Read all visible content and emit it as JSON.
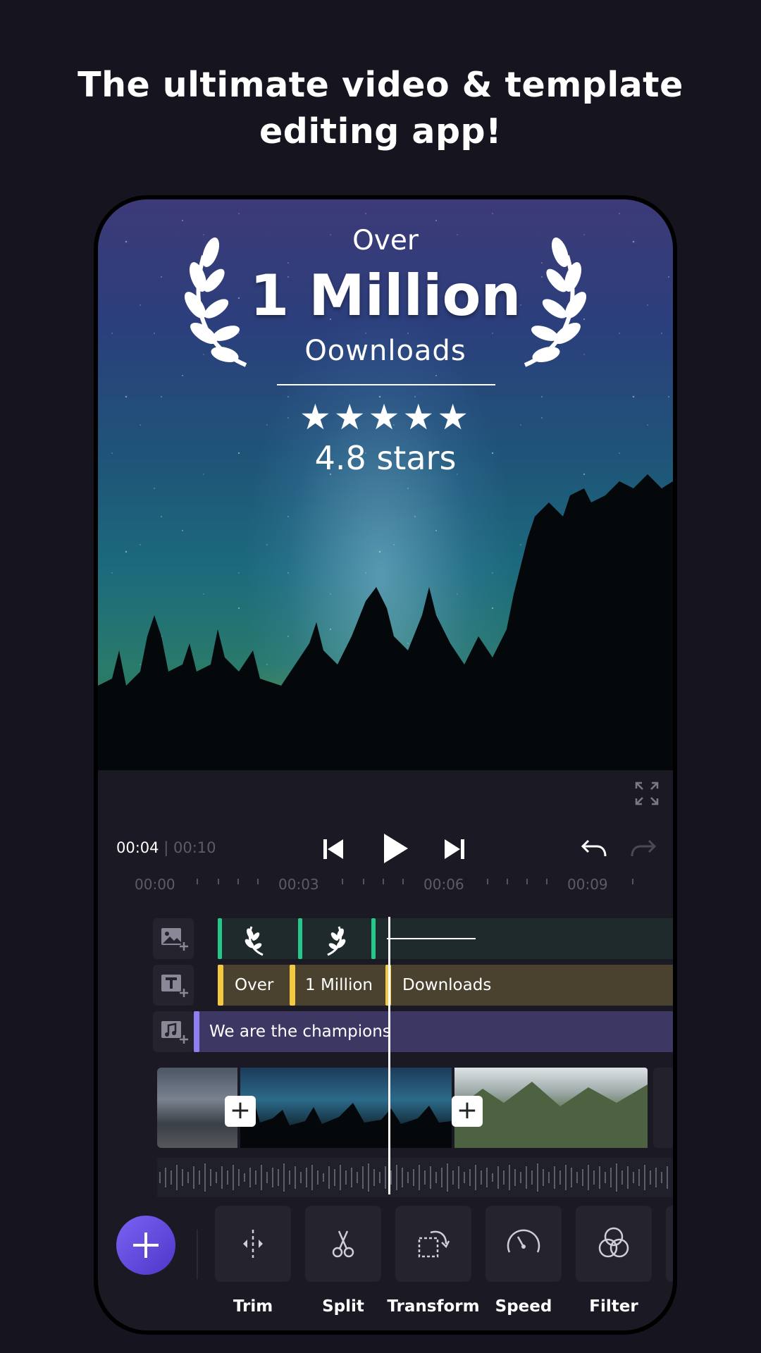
{
  "headline": {
    "line1": "The ultimate video & template",
    "line2": "editing app!"
  },
  "preview": {
    "over": "Over",
    "million": "1 Million",
    "downloads": "Oownloads",
    "stars": "★★★★★",
    "rating": "4.8 stars"
  },
  "player": {
    "current_time": "00:04",
    "separator": " | ",
    "total_time": "00:10"
  },
  "ruler": {
    "labels": [
      "00:00",
      "00:03",
      "00:06",
      "00:09"
    ]
  },
  "tracks": {
    "text_segments": [
      "Over",
      "1 Million",
      "Downloads"
    ],
    "music_title": "We are the champions"
  },
  "toolbar": {
    "tools": [
      "Trim",
      "Split",
      "Transform",
      "Speed",
      "Filter"
    ]
  },
  "icons": {
    "add": "plus-icon",
    "play": "play-icon",
    "prev": "skip-previous-icon",
    "next": "skip-next-icon",
    "undo": "undo-icon",
    "redo": "redo-icon",
    "fullscreen": "fullscreen-icon"
  },
  "colors": {
    "background": "#16151f",
    "image_track_marker": "#24c88b",
    "text_track_marker": "#f3c93f",
    "music_track_marker": "#8f7ff0",
    "fab": "#6a52e6"
  }
}
